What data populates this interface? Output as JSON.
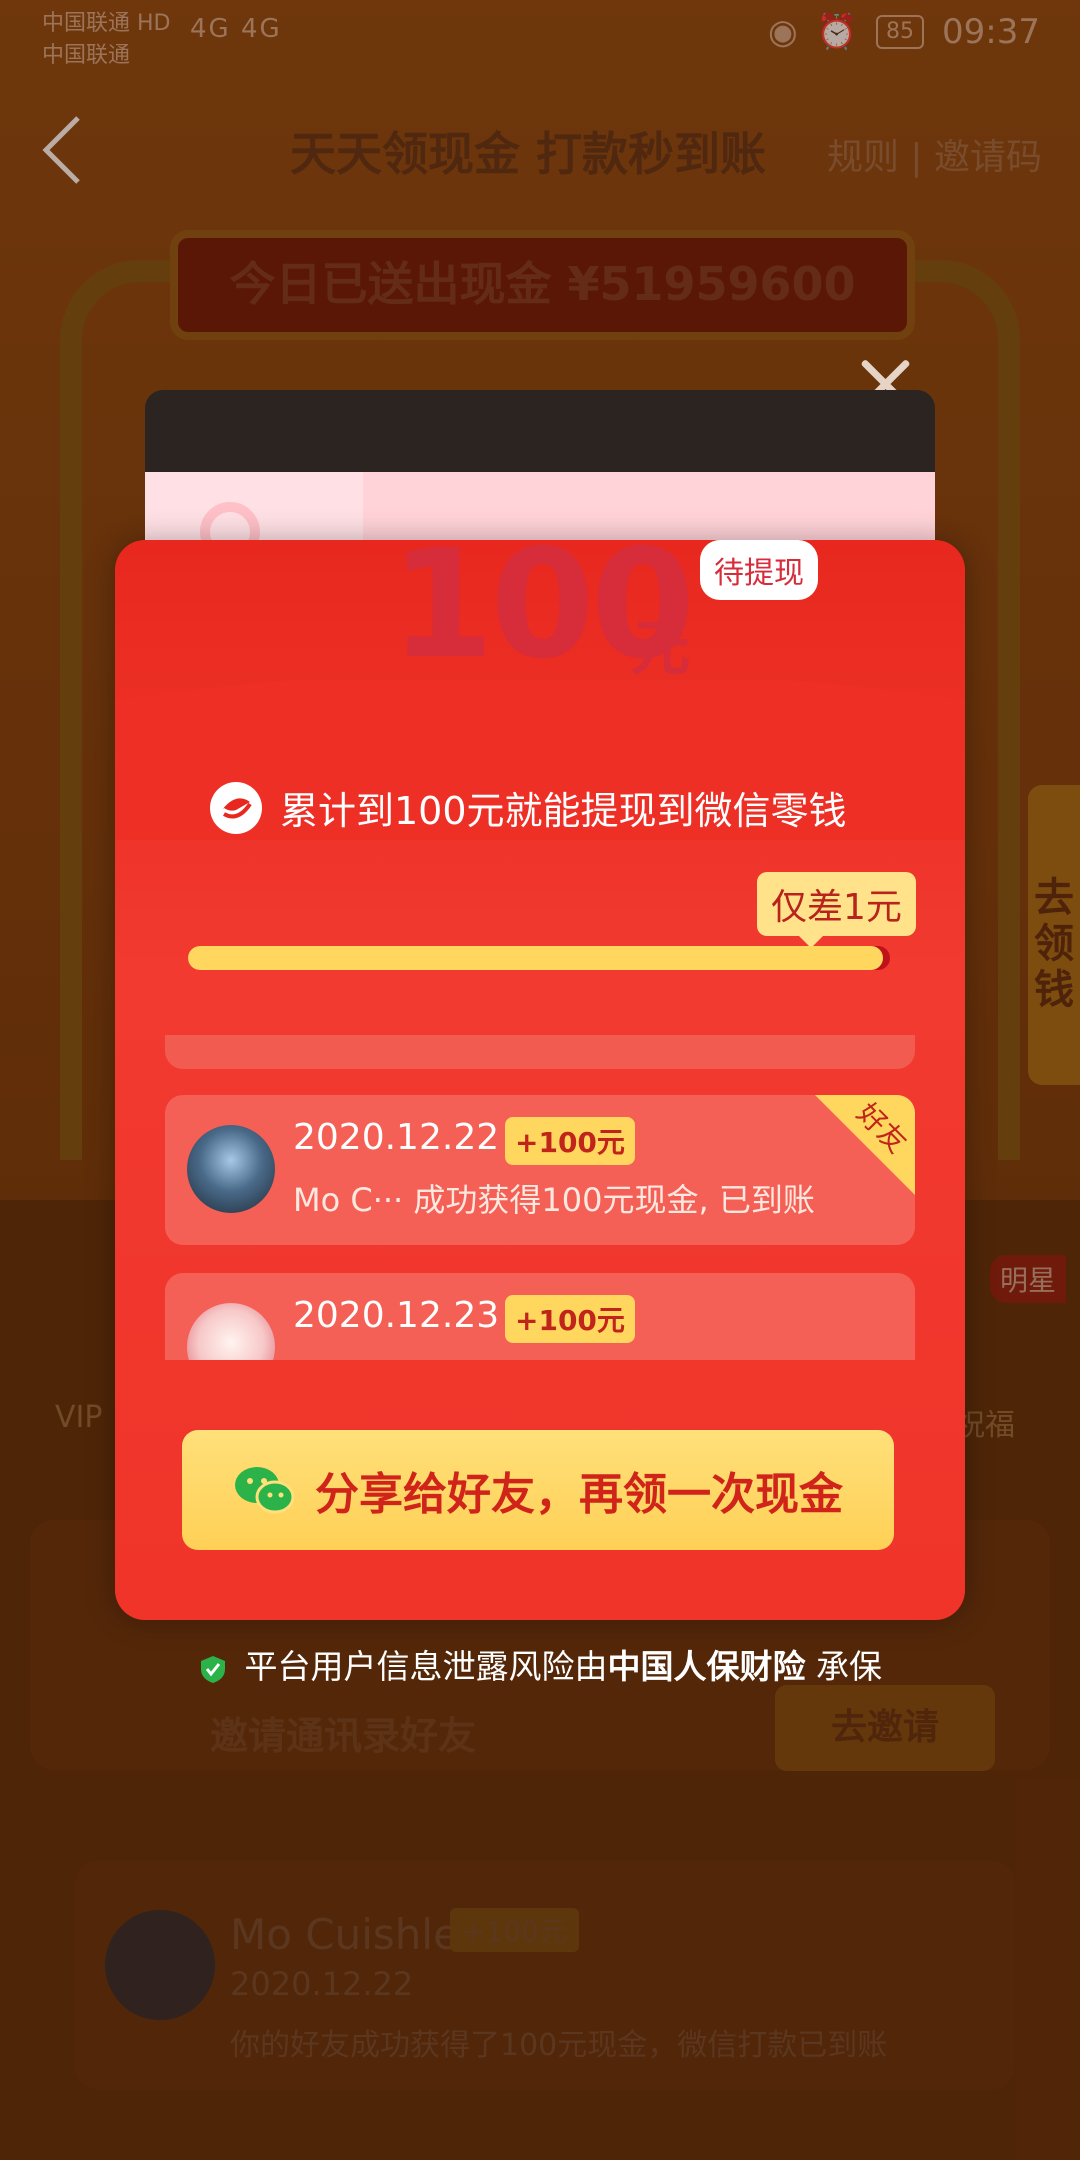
{
  "status_bar": {
    "carrier_line1": "中国联通 HD",
    "carrier_line2": "中国联通",
    "signal": "4G  4G",
    "battery": "85",
    "time": "09:37"
  },
  "header": {
    "title": "天天领现金 打款秒到账",
    "rules_link": "规则",
    "invite_code_link": "邀请码"
  },
  "banner": {
    "cash_sent": "今日已送出现金 ¥51959600"
  },
  "side_tab": {
    "label": "去领钱"
  },
  "background": {
    "vip_label": "VIP",
    "bless_label": "祝福",
    "star_badge": "明星",
    "invite_contacts_label": "邀请通讯录好友",
    "invite_button": "去邀请",
    "feed": {
      "name": "Mo Cuishle",
      "badge": "+100元",
      "date": "2020.12.22",
      "message": "你的好友成功获得了100元现金，微信打款已到账"
    }
  },
  "modal": {
    "amount": "100",
    "amount_unit": "元",
    "pending_label": "待提现",
    "withdraw_hint": "累计到100元就能提现到微信零钱",
    "difference_tag": "仅差1元",
    "progress": 0.99,
    "entries": [
      {
        "date": "2020.12.22",
        "badge": "+100元",
        "message": "Mo C···  成功获得100元现金, 已到账",
        "corner": "好友",
        "avatar_icon": "road-landscape-avatar"
      },
      {
        "date": "2020.12.23",
        "badge": "+100元",
        "message": "",
        "corner": "",
        "avatar_icon": "cartoon-girl-avatar"
      }
    ],
    "share_button": "分享给好友，再领一次现金",
    "insurance_prefix": "平台用户信息泄露风险由",
    "insurance_brand": "中国人保财险",
    "insurance_suffix": "承保"
  },
  "colors": {
    "envelope_red": "#e8281e",
    "accent_yellow": "#ffd75e",
    "amount_red": "#d72c3a"
  }
}
